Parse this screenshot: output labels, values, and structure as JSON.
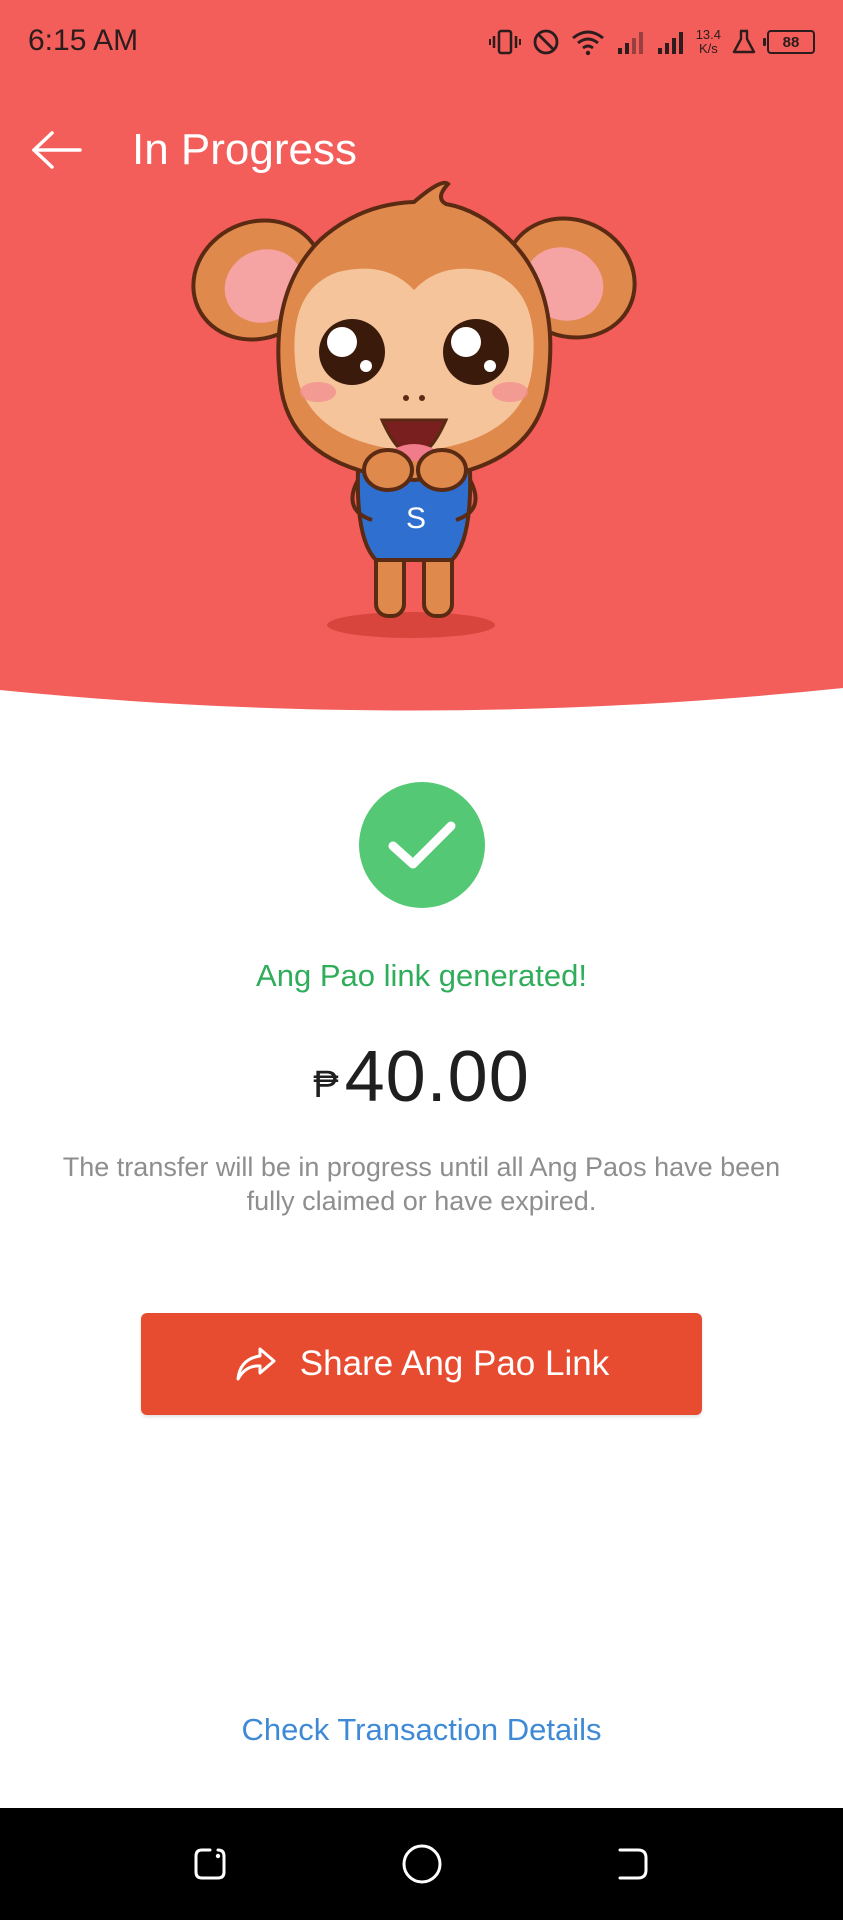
{
  "status_bar": {
    "time": "6:15 AM",
    "net_speed_value": "13.4",
    "net_speed_unit": "K/s",
    "battery_level": "88",
    "icons": [
      "vibrate-icon",
      "do-not-disturb-icon",
      "wifi-icon",
      "signal-icon",
      "signal-icon",
      "flask-icon",
      "battery-icon"
    ]
  },
  "header": {
    "title": "In Progress",
    "back_icon": "arrow-left-icon",
    "background_color": "#f35d5a"
  },
  "mascot": {
    "shirt_letter": "S"
  },
  "result": {
    "status_icon": "check-icon",
    "message": "Ang Pao link generated!",
    "currency_symbol": "₱",
    "amount": "40.00",
    "info": "The transfer will be in progress until all Ang Paos have been fully claimed or have expired."
  },
  "actions": {
    "share_label": "Share Ang Pao Link",
    "share_icon": "share-arrow-icon",
    "details_link": "Check Transaction Details"
  },
  "colors": {
    "accent": "#e84c30",
    "success": "#55c876",
    "link": "#3f8ad6"
  },
  "nav_bar": {
    "icons": [
      "recent-apps-icon",
      "home-icon",
      "back-icon"
    ]
  }
}
